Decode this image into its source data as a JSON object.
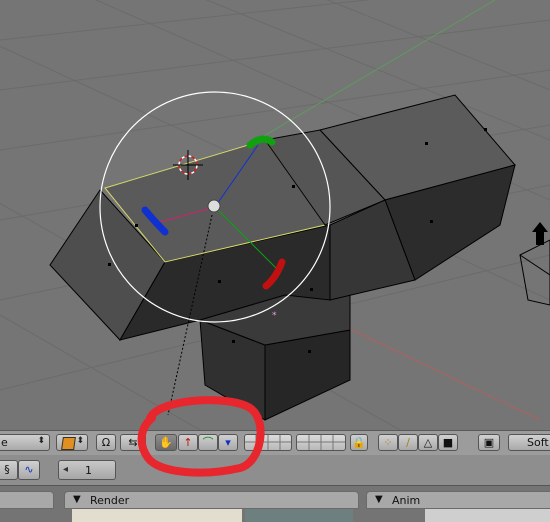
{
  "header": {
    "mode_select_value": "e",
    "frame_number": "1",
    "render_shading_label": "Soft"
  },
  "panels": [
    {
      "title": "Render"
    },
    {
      "title": "Anim"
    }
  ],
  "icons": {
    "mode_arrows": "updown-arrow-icon",
    "object_mode": "orange-cube-icon",
    "pivot": "pivot-icon",
    "proportional": "transform-arrows-icon",
    "hand": "hand-icon",
    "translate": "red-arrow-icon",
    "rotate": "green-rotate-icon",
    "scale": "blue-scale-icon",
    "lock": "lock-icon",
    "vertex_select": "vertex-select-icon",
    "edge_select": "edge-select-icon",
    "face_select": "face-select-icon",
    "occlude": "occlude-cube-icon",
    "render_icon": "render-picture-icon",
    "ipo_curve": "curve-icon",
    "wave": "wave-icon"
  },
  "colors": {
    "viewport_bg": "#757575",
    "grid_line": "#6b6b6b",
    "x_axis": "#b06060",
    "y_axis": "#5f9a5f",
    "annotation": "#e8262e",
    "selected_face_outline": "#d8d868",
    "manipulator_x": "#c01010",
    "manipulator_y": "#10a010",
    "manipulator_z": "#1030d0"
  }
}
